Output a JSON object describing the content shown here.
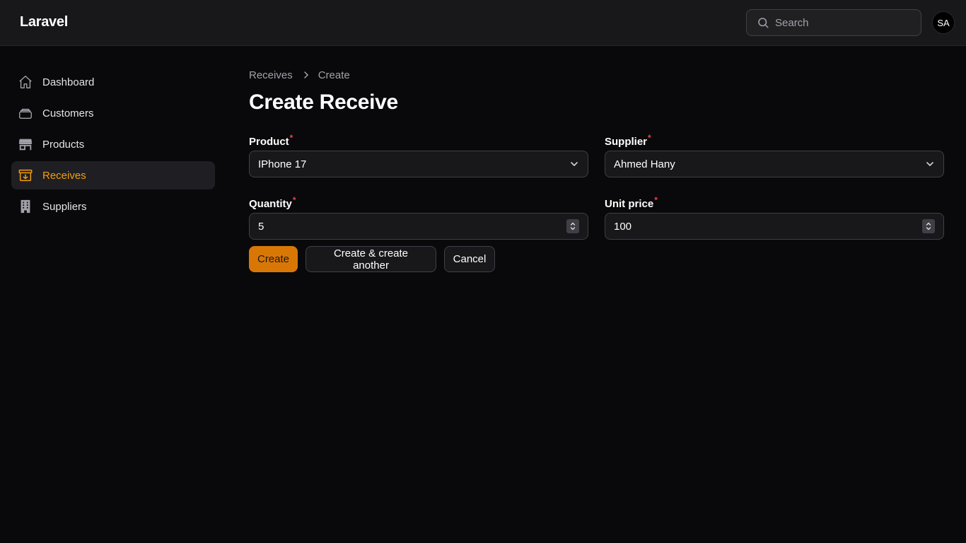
{
  "app": {
    "brand": "Laravel"
  },
  "header": {
    "search_placeholder": "Search",
    "avatar_initials": "SA"
  },
  "sidebar": {
    "items": [
      {
        "label": "Dashboard",
        "icon": "home-icon",
        "active": false
      },
      {
        "label": "Customers",
        "icon": "stack-icon",
        "active": false
      },
      {
        "label": "Products",
        "icon": "storefront-icon",
        "active": false
      },
      {
        "label": "Receives",
        "icon": "archive-box-arrow-down-icon",
        "active": true
      },
      {
        "label": "Suppliers",
        "icon": "building-icon",
        "active": false
      }
    ]
  },
  "breadcrumb": {
    "parent": "Receives",
    "current": "Create"
  },
  "page": {
    "title": "Create Receive"
  },
  "form": {
    "product": {
      "label": "Product",
      "value": "IPhone 17"
    },
    "supplier": {
      "label": "Supplier",
      "value": "Ahmed Hany"
    },
    "quantity": {
      "label": "Quantity",
      "value": "5"
    },
    "unit_price": {
      "label": "Unit price",
      "value": "100"
    },
    "required_mark": "*"
  },
  "actions": {
    "create": "Create",
    "create_another": "Create & create another",
    "cancel": "Cancel"
  },
  "colors": {
    "accent": "#f59e0b",
    "primary_button": "#d97706",
    "background": "#09090b",
    "topbar": "#18181b",
    "required": "#ef4444"
  }
}
